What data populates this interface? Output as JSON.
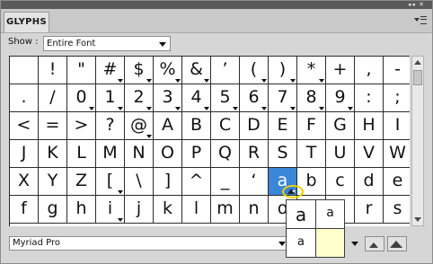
{
  "panel": {
    "tab_label": "GLYPHS",
    "collapse_glyph": "◂◂ ✕",
    "menu_icon": "panel-menu-icon"
  },
  "show": {
    "label": "Show :",
    "value": "Entire Font"
  },
  "glyph_rows": [
    [
      " ",
      "!",
      "\"",
      "#",
      "$",
      "%",
      "&",
      "’",
      "(",
      ")",
      "*",
      "+",
      ",",
      "-"
    ],
    [
      ".",
      "/",
      "0",
      "1",
      "2",
      "3",
      "4",
      "5",
      "6",
      "7",
      "8",
      "9",
      ":",
      ";"
    ],
    [
      "<",
      "=",
      ">",
      "?",
      "@",
      "A",
      "B",
      "C",
      "D",
      "E",
      "F",
      "G",
      "H",
      "I"
    ],
    [
      "J",
      "K",
      "L",
      "M",
      "N",
      "O",
      "P",
      "Q",
      "R",
      "S",
      "T",
      "U",
      "V",
      "W"
    ],
    [
      "X",
      "Y",
      "Z",
      "[",
      "\\",
      "]",
      "^",
      "_",
      "‘",
      "a",
      "b",
      "c",
      "d",
      "e"
    ],
    [
      "f",
      "g",
      "h",
      "i",
      "j",
      "k",
      "l",
      "m",
      "n",
      "o",
      "p",
      "q",
      "r",
      "s"
    ]
  ],
  "alternates_marker": {
    "rows": [
      [
        false,
        false,
        false,
        true,
        true,
        true,
        true,
        false,
        true,
        true,
        true,
        false,
        false,
        false
      ],
      [
        false,
        false,
        true,
        true,
        true,
        true,
        true,
        true,
        true,
        true,
        true,
        true,
        false,
        false
      ],
      [
        false,
        false,
        false,
        false,
        true,
        false,
        false,
        false,
        false,
        false,
        false,
        false,
        false,
        false
      ],
      [
        false,
        false,
        false,
        false,
        false,
        false,
        false,
        false,
        false,
        false,
        false,
        false,
        false,
        false
      ],
      [
        false,
        false,
        false,
        true,
        false,
        false,
        false,
        false,
        false,
        true,
        false,
        false,
        false,
        false
      ],
      [
        false,
        false,
        false,
        true,
        false,
        false,
        false,
        false,
        false,
        false,
        false,
        false,
        false,
        false
      ]
    ]
  },
  "selected_glyph": "a",
  "alternates_popup": {
    "items": [
      "a",
      "a",
      "a",
      ""
    ]
  },
  "font": {
    "family": "Myriad Pro"
  },
  "colors": {
    "selection": "#3a86d8",
    "highlight_circle": "#f0d000",
    "popup_empty_cell": "#ffffcc"
  }
}
